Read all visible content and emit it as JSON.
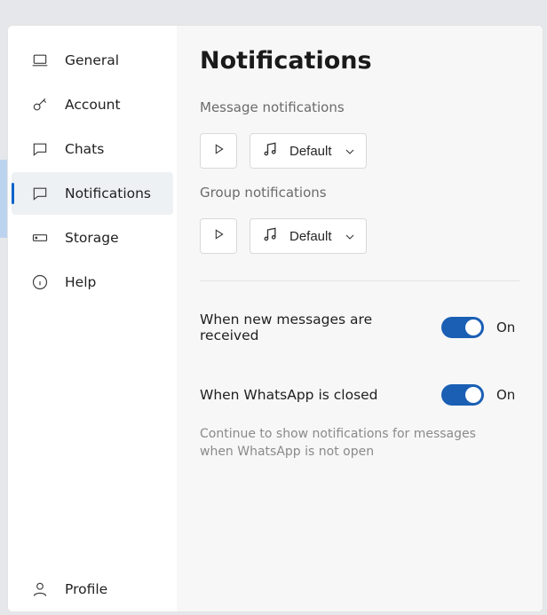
{
  "sidebar": {
    "items": [
      {
        "key": "general",
        "label": "General"
      },
      {
        "key": "account",
        "label": "Account"
      },
      {
        "key": "chats",
        "label": "Chats"
      },
      {
        "key": "notifications",
        "label": "Notifications"
      },
      {
        "key": "storage",
        "label": "Storage"
      },
      {
        "key": "help",
        "label": "Help"
      }
    ],
    "footer": {
      "key": "profile",
      "label": "Profile"
    },
    "selected_key": "notifications"
  },
  "content": {
    "title": "Notifications",
    "message_section": {
      "label": "Message notifications",
      "sound_selected": "Default"
    },
    "group_section": {
      "label": "Group notifications",
      "sound_selected": "Default"
    },
    "toggle_new_messages": {
      "label": "When new messages are received",
      "state_text": "On",
      "on": true
    },
    "toggle_wa_closed": {
      "label": "When WhatsApp is closed",
      "state_text": "On",
      "on": true,
      "help": "Continue to show notifications for messages when WhatsApp is not open"
    }
  }
}
